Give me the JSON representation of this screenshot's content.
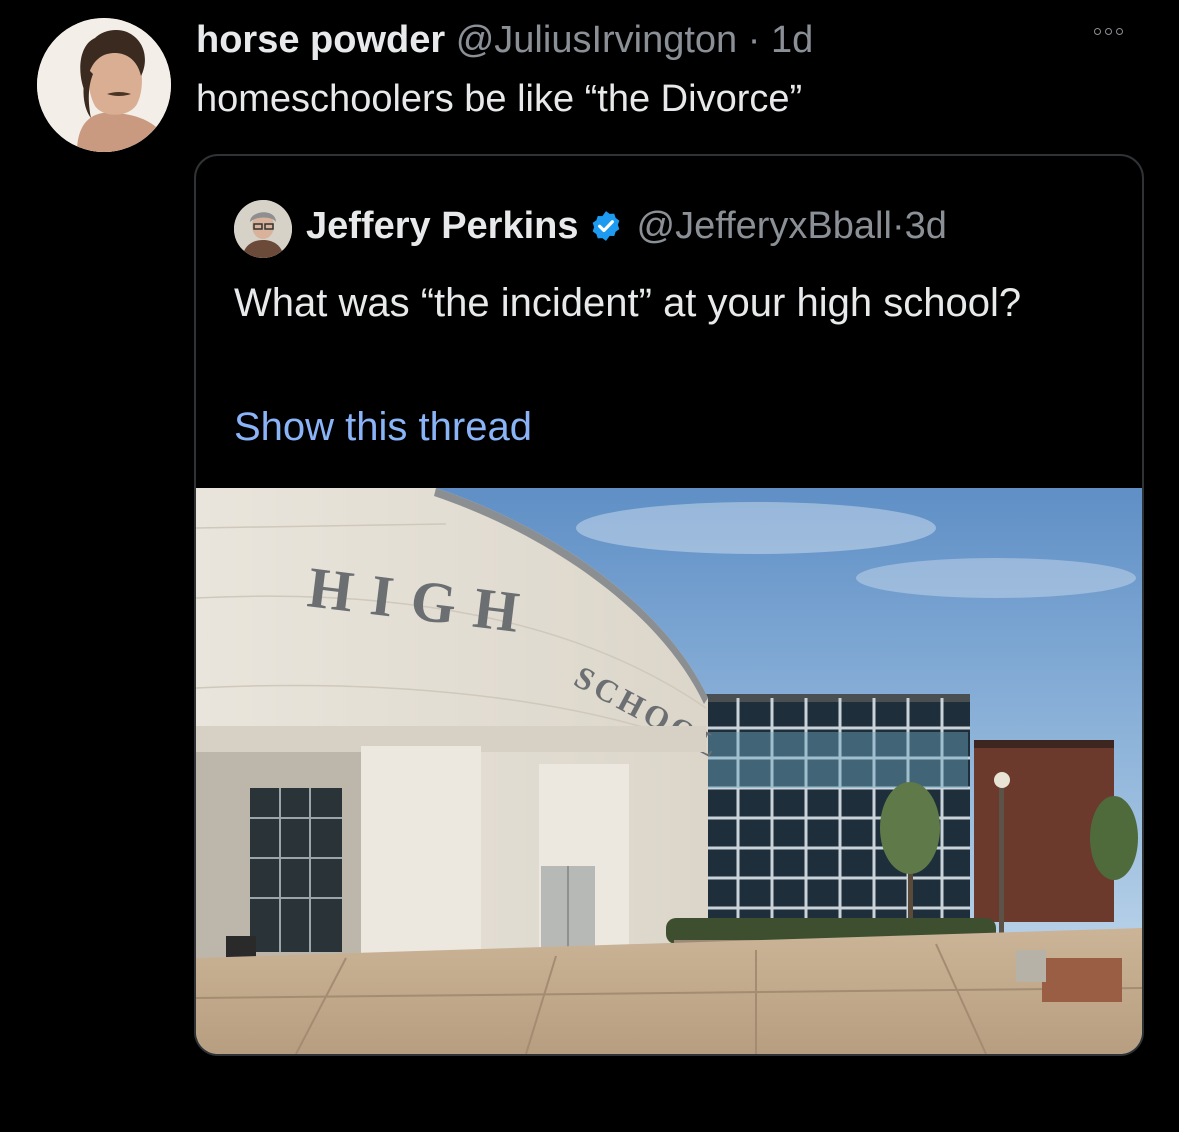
{
  "tweet": {
    "display_name": "horse powder",
    "handle": "@JuliusIrvington",
    "separator": "·",
    "time": "1d",
    "text": "homeschoolers be like “the Divorce”",
    "avatar_icon": "profile-photo",
    "more_icon": "more-options-icon"
  },
  "quote": {
    "display_name": "Jeffery Perkins",
    "verified_icon": "verified-badge-icon",
    "handle": "@JefferyxBball",
    "separator": "·",
    "time": "3d",
    "text": "What was “the incident” at your high school?",
    "show_thread": "Show this thread",
    "media": {
      "sign_word_1": "HIGH",
      "sign_word_2": "SCHOOL"
    }
  },
  "colors": {
    "background": "#000000",
    "primary_text": "#e7e9ea",
    "secondary_text": "#8b9096",
    "link": "#8ab4f8",
    "verified": "#1d9bf0",
    "card_border": "#2f3336"
  }
}
